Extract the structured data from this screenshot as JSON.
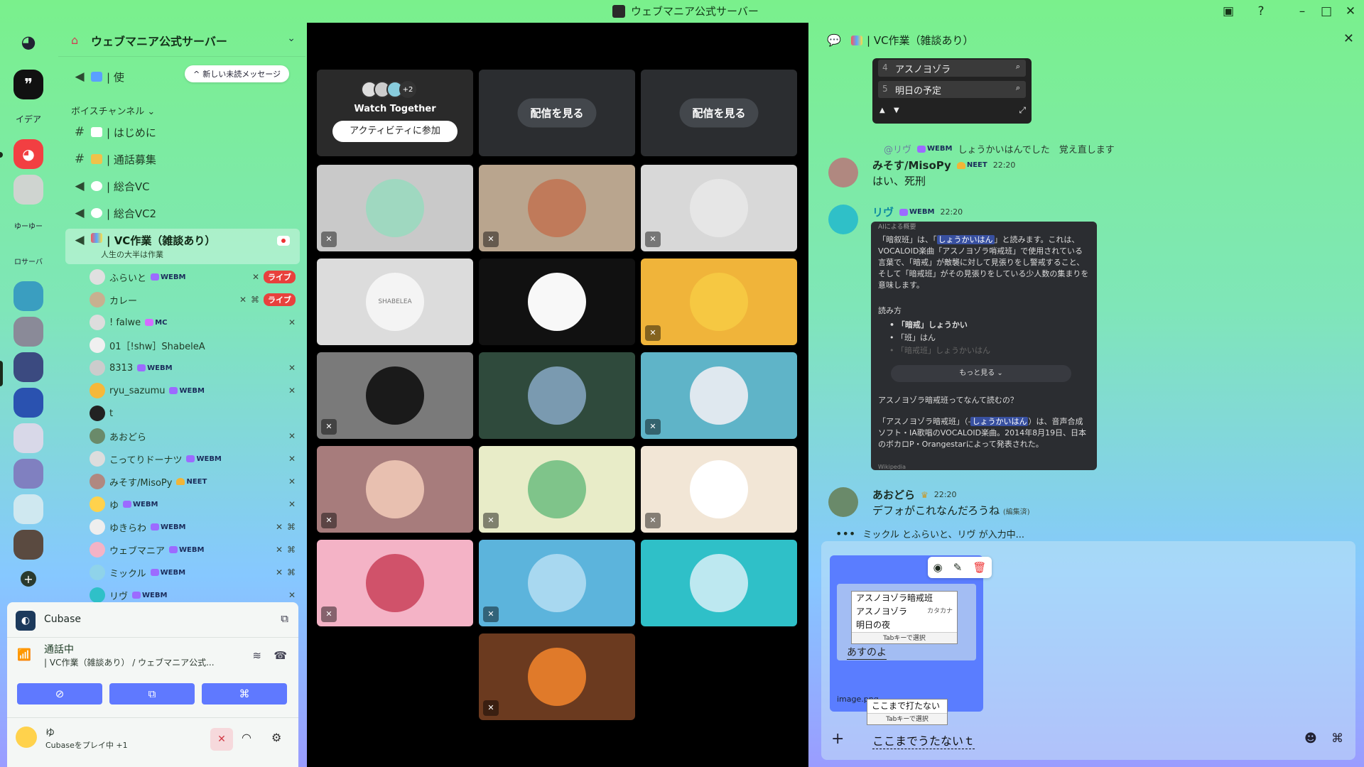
{
  "window": {
    "title": "ウェブマニア公式サーバー"
  },
  "rail": {
    "labels": [
      "イデア",
      "ゆーゆー",
      "ロサーバ"
    ]
  },
  "server": {
    "name": "ウェブマニア公式サーバー"
  },
  "sidebar": {
    "unread_banner": "新しい未読メッセージ",
    "top_channel_prefix": "| 使",
    "voice_category": "ボイスチャンネル",
    "channels": [
      {
        "label": "| はじめに",
        "type": "text"
      },
      {
        "label": "| 通話募集",
        "type": "text"
      },
      {
        "label": "| 総合VC",
        "type": "voice"
      },
      {
        "label": "| 総合VC2",
        "type": "voice"
      }
    ],
    "active_channel": {
      "label": "| VC作業（雑談あり）",
      "subtitle": "人生の大半は作業"
    },
    "voice_users": [
      {
        "name": "ふらいと",
        "tag": "WEBM",
        "live": "ライブ"
      },
      {
        "name": "カレー",
        "tag": "",
        "live": "ライブ"
      },
      {
        "name": "! falwe",
        "tag": "MC",
        "live": ""
      },
      {
        "name": "01［!shw］ShabeleA",
        "tag": "",
        "live": ""
      },
      {
        "name": "8313",
        "tag": "WEBM",
        "live": ""
      },
      {
        "name": "ryu_sazumu",
        "tag": "WEBM",
        "live": ""
      },
      {
        "name": "t",
        "tag": "",
        "live": ""
      },
      {
        "name": "あおどら",
        "tag": "",
        "live": ""
      },
      {
        "name": "こってりドーナツ",
        "tag": "WEBM",
        "live": ""
      },
      {
        "name": "みそす/MisoPy",
        "tag": "NEET",
        "live": ""
      },
      {
        "name": "ゆ",
        "tag": "WEBM",
        "live": ""
      },
      {
        "name": "ゆきらわ",
        "tag": "WEBM",
        "live": ""
      },
      {
        "name": "ウェブマニア",
        "tag": "WEBM",
        "live": ""
      },
      {
        "name": "ミックル",
        "tag": "WEBM",
        "live": ""
      },
      {
        "name": "リヴ",
        "tag": "WEBM",
        "live": ""
      }
    ]
  },
  "activity": {
    "app_name": "Cubase",
    "voice_status": "通話中",
    "voice_location": "| VC作業（雑談あり） / ウェブマニア公式...",
    "user_name": "ゆ",
    "user_status": "Cubaseをプレイ中 +1"
  },
  "stage": {
    "watch_together": {
      "title": "Watch Together",
      "join_label": "アクティビティに参加",
      "extra_count": "+2"
    },
    "stream_button": "配信を見る",
    "tile_colors": [
      "#c9c9c9",
      "#b9a58e",
      "#d8d8d8",
      "#dcdcdc",
      "#111111",
      "#f0b43a",
      "#7a7a7a",
      "#2f4a3c",
      "#5fb4c8",
      "#a77c7c",
      "#e8ecc8",
      "#f2e6d6",
      "#f4b3c6",
      "#5cb4dc",
      "#2fc0c8",
      "#6b3a1f"
    ],
    "shabelea_text": "SHABELEA"
  },
  "chat": {
    "title": "| VC作業（雑談あり）",
    "search_results": [
      {
        "n": "4",
        "text": "アスノヨゾラ"
      },
      {
        "n": "5",
        "text": "明日の予定"
      }
    ],
    "reply_ref": {
      "user": "@リヴ",
      "tag": "WEBM",
      "text": "しょうかいはんでした　覚え直します"
    },
    "messages": [
      {
        "user": "みそす/MisoPy",
        "tag": "NEET",
        "time": "22:20",
        "body": "はい、死刑"
      },
      {
        "user": "リヴ",
        "tag": "WEBM",
        "time": "22:20",
        "body": ""
      },
      {
        "user": "あおどら",
        "tag": "",
        "time": "22:20",
        "body": "デフォがこれなんだろうね",
        "edited": "(編集済)"
      }
    ],
    "embed": {
      "header": "AIによる概要",
      "p1a": "「暗叙班」は、「",
      "p1hl": "しょうかいはん",
      "p1b": "」と読みます。これは、VOCALOID楽曲「アスノヨゾラ哨戒班」で使用されている言葉で、「暗戒」が敵襲に対して見張りをし警戒すること、そして「暗戒班」がその見張りをしている少人数の集まりを意味します。",
      "reading_title": "読み方",
      "reading1": "「暗戒」しょうかい",
      "reading2": "「班」はん",
      "reading3": "「暗戒班」しょうかいはん",
      "more": "もっと見る",
      "q": "アスノヨゾラ暗戒班ってなんて読むの？",
      "p2a": "「アスノヨゾラ暗戒班」（-",
      "p2hl": "しょうかいはん",
      "p2b": "）は、音声合成ソフト・IA歌唱のVOCALOID楽曲。2014年8月19日、日本のボカロP・Orangestarによって発表された。",
      "source": "Wikipedia"
    },
    "typing": "ミックル とふらいと、リヴ が入力中..."
  },
  "composer": {
    "attachment_name": "image.png",
    "ime_candidates": [
      {
        "text": "アスノヨゾラ暗戒班",
        "kind": ""
      },
      {
        "text": "アスノヨゾラ",
        "kind": "カタカナ"
      },
      {
        "text": "明日の夜",
        "kind": ""
      }
    ],
    "ime_hint": "Tabキーで選択",
    "inner_text": "あすのよ",
    "bottom_candidate": "ここまで打たない",
    "bottom_hint": "Tabキーで選択",
    "input_text": "ここまでうたないｔ"
  }
}
